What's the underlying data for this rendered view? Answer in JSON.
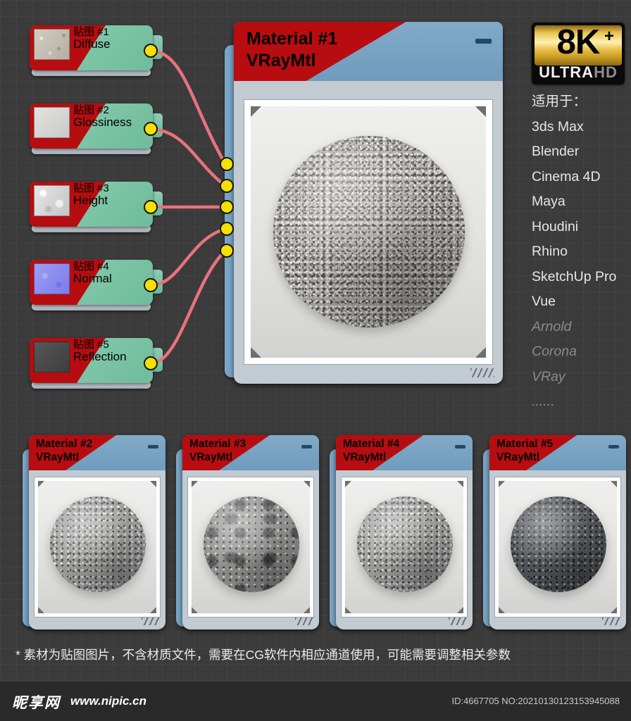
{
  "background": {
    "color": "#3b3b3b",
    "grid": true,
    "grid_size_px": 23
  },
  "texture_nodes": [
    {
      "title": "贴图 #1",
      "channel": "Diffuse",
      "swatch": "sw-diffuse",
      "port": "output-port"
    },
    {
      "title": "贴图 #2",
      "channel": "Glossiness",
      "swatch": "sw-gloss",
      "port": "output-port"
    },
    {
      "title": "贴图 #3",
      "channel": "Height",
      "swatch": "sw-height",
      "port": "output-port"
    },
    {
      "title": "贴图 #4",
      "channel": "Normal",
      "swatch": "sw-normal",
      "port": "output-port"
    },
    {
      "title": "贴图 #5",
      "channel": "Reflection",
      "swatch": "sw-reflection",
      "port": "output-port"
    }
  ],
  "main_material": {
    "name": "Material #1",
    "type": "VRayMtl",
    "minimize_label": "",
    "input_ports": 5,
    "preview": "granite-sphere"
  },
  "badge": {
    "resolution": "8K",
    "plus": "+",
    "ultra": "ULTRA",
    "hd": "HD",
    "gold": "#e8c251"
  },
  "compatibility": {
    "heading": "适用于：",
    "items": [
      {
        "label": "3ds Max",
        "dim": false
      },
      {
        "label": "Blender",
        "dim": false
      },
      {
        "label": "Cinema 4D",
        "dim": false
      },
      {
        "label": "Maya",
        "dim": false
      },
      {
        "label": "Houdini",
        "dim": false
      },
      {
        "label": "Rhino",
        "dim": false
      },
      {
        "label": "SketchUp  Pro",
        "dim": false
      },
      {
        "label": "Vue",
        "dim": false
      },
      {
        "label": "Arnold",
        "dim": true
      },
      {
        "label": "Corona",
        "dim": true
      },
      {
        "label": "VRay",
        "dim": true
      },
      {
        "label": "......",
        "dim": true
      }
    ]
  },
  "material_cards": [
    {
      "name": "Material #2",
      "type": "VRayMtl",
      "sphere": "sph-concrete"
    },
    {
      "name": "Material #3",
      "type": "VRayMtl",
      "sphere": "sph-rough"
    },
    {
      "name": "Material #4",
      "type": "VRayMtl",
      "sphere": "sph-concrete"
    },
    {
      "name": "Material #5",
      "type": "VRayMtl",
      "sphere": "sph-dark"
    }
  ],
  "footer": {
    "note": "* 素材为贴图图片，不含材质文件，需要在CG软件内相应通道使用，可能需要调整相关参数",
    "watermark_logo": "昵享网",
    "watermark_url": "www.nipic.cn",
    "asset_id": "ID:4667705 NO:20210130123153945088"
  }
}
